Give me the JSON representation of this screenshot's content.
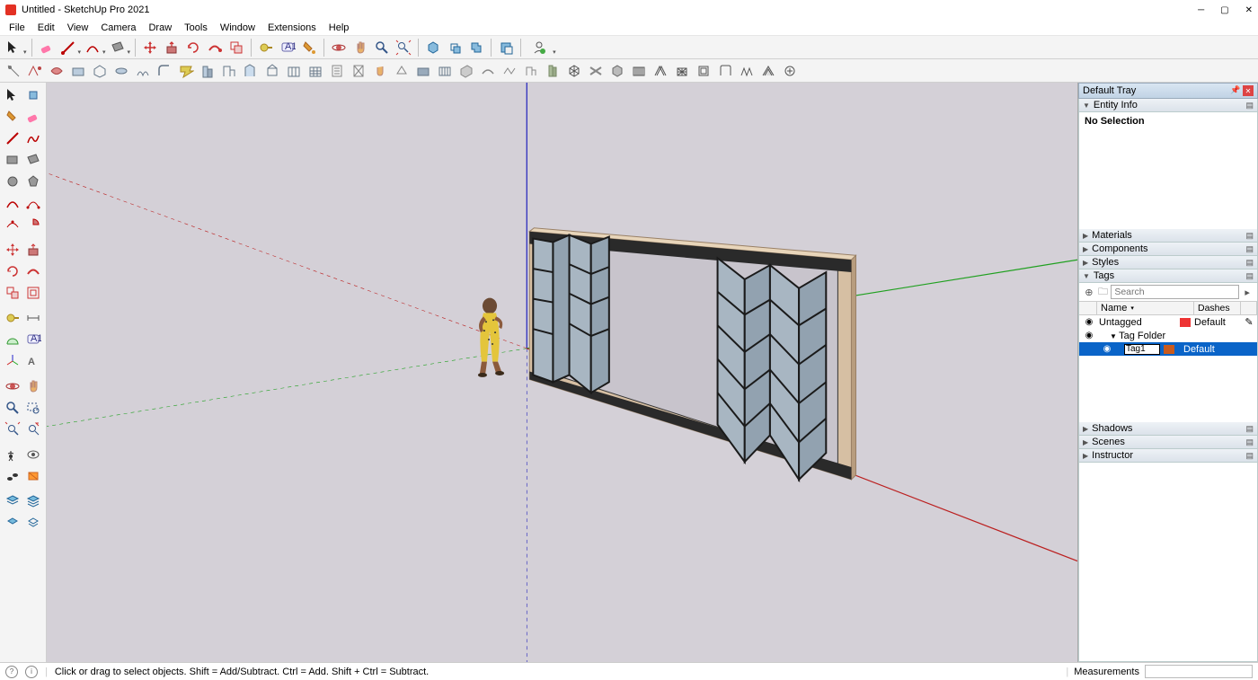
{
  "window": {
    "title": "Untitled - SketchUp Pro 2021"
  },
  "menu": [
    "File",
    "Edit",
    "View",
    "Camera",
    "Draw",
    "Tools",
    "Window",
    "Extensions",
    "Help"
  ],
  "tray": {
    "title": "Default Tray",
    "panels": {
      "entity": {
        "label": "Entity Info",
        "body": "No Selection"
      },
      "materials": {
        "label": "Materials"
      },
      "components": {
        "label": "Components"
      },
      "styles": {
        "label": "Styles"
      },
      "tags": {
        "label": "Tags",
        "search_placeholder": "Search",
        "cols": {
          "name": "Name",
          "dashes": "Dashes"
        },
        "rows": {
          "untagged": {
            "label": "Untagged",
            "dash": "Default"
          },
          "folder": {
            "label": "Tag Folder"
          },
          "tag1": {
            "value": "Tag1",
            "dash": "Default"
          }
        }
      },
      "shadows": {
        "label": "Shadows"
      },
      "scenes": {
        "label": "Scenes"
      },
      "instructor": {
        "label": "Instructor"
      }
    }
  },
  "status": {
    "hint": "Click or drag to select objects. Shift = Add/Subtract. Ctrl = Add. Shift + Ctrl = Subtract.",
    "measure_label": "Measurements"
  }
}
